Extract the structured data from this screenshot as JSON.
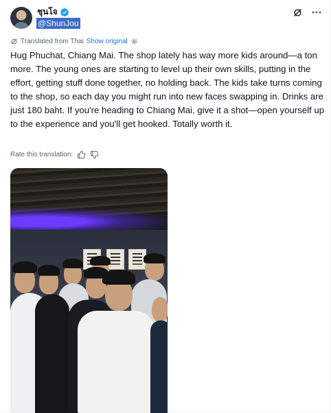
{
  "author": {
    "display_name": "ชุนโจ",
    "handle": "@ShunJou"
  },
  "translation": {
    "label": "Translated from Thai",
    "show_original": "Show original"
  },
  "tweet": {
    "text": "Hug Phuchat, Chiang Mai. The shop lately has way more kids around—a ton more. The young ones are starting to level up their own skills, putting in the effort, getting stuff done together, no holding back. The kids take turns coming to the shop, so each day you might run into new faces swapping in. Drinks are just 180 baht. If you're heading to Chiang Mai, give it a shot—open yourself up to the experience and you'll get hooked. Totally worth it."
  },
  "rate": {
    "label": "Rate this translation:"
  },
  "icons": {
    "verified": "verified-badge-icon",
    "grok": "grok-icon",
    "more": "more-icon",
    "translate": "translate-icon",
    "gear": "gear-icon",
    "thumbs_up": "thumbs-up-icon",
    "thumbs_down": "thumbs-down-icon"
  },
  "colors": {
    "accent": "#1d9bf0",
    "link": "#1d6fe0",
    "handle_highlight": "#3b6ac9",
    "secondary_text": "#536471"
  }
}
